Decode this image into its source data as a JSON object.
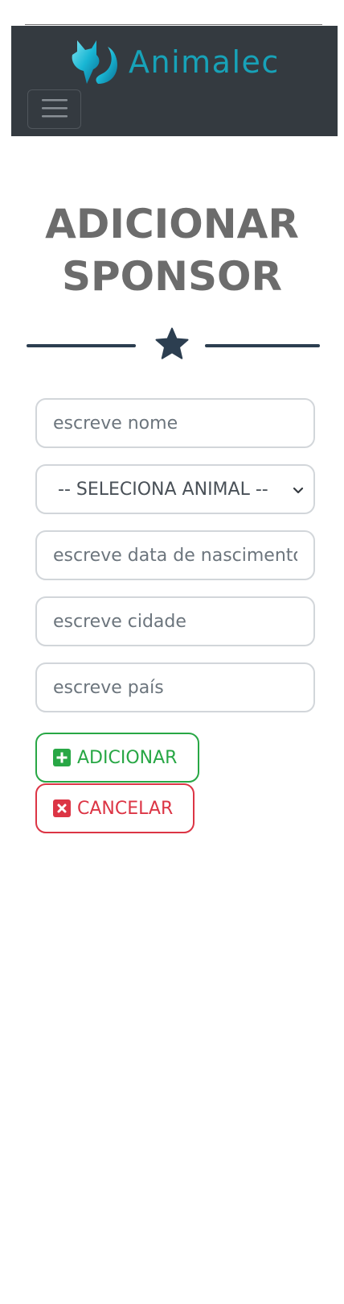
{
  "navbar": {
    "brand_name": "Animalec",
    "brand_color": "#17a2b8",
    "background": "#343a40",
    "logo_icon": "fox-icon",
    "toggler_icon": "hamburger-icon"
  },
  "page": {
    "title_line1": "ADICIONAR",
    "title_line2": "SPONSOR",
    "divider_icon": "star-icon"
  },
  "form": {
    "name_placeholder": "escreve nome",
    "animal_select": {
      "selected": "-- SELECIONA ANIMAL --"
    },
    "birthdate_placeholder": "escreve data de nascimento",
    "city_placeholder": "escreve cidade",
    "country_placeholder": "escreve país",
    "add_button": "ADICIONAR",
    "add_icon": "plus-square-icon",
    "cancel_button": "CANCELAR",
    "cancel_icon": "x-square-icon"
  },
  "colors": {
    "success": "#28a745",
    "danger": "#dc3545",
    "accent_dark": "#2c3e50",
    "title": "#6c6c6c"
  }
}
